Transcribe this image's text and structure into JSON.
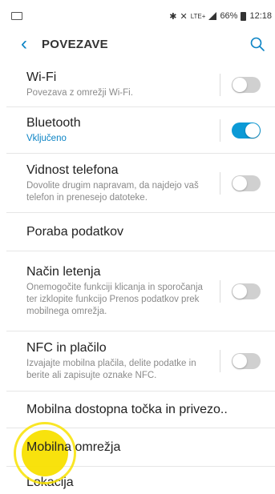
{
  "status_bar": {
    "battery_percent": "66%",
    "time": "12:18",
    "network": "LTE+"
  },
  "header": {
    "title": "POVEZAVE",
    "back_icon": "back-arrow-icon",
    "search_icon": "search-icon"
  },
  "items": [
    {
      "title": "Wi-Fi",
      "subtitle": "Povezava z omrežji Wi-Fi.",
      "toggle": false
    },
    {
      "title": "Bluetooth",
      "subtitle": "Vključeno",
      "toggle": true
    },
    {
      "title": "Vidnost telefona",
      "subtitle": "Dovolite drugim napravam, da najdejo vaš telefon in prenesejo datoteke.",
      "toggle": false
    },
    {
      "title": "Poraba podatkov"
    },
    {
      "title": "Način letenja",
      "subtitle": "Onemogočite funkciji klicanja in sporočanja ter izklopite funkcijo Prenos podatkov prek mobilnega omrežja.",
      "toggle": false
    },
    {
      "title": "NFC in plačilo",
      "subtitle": "Izvajajte mobilna plačila, delite podatke in berite ali zapisujte oznake NFC.",
      "toggle": false
    },
    {
      "title": "Mobilna dostopna točka in privezo.."
    },
    {
      "title": "Mobilna omrežja"
    },
    {
      "title": "Lokacija"
    }
  ],
  "colors": {
    "accent": "#0c84c5",
    "toggle_on": "#0c9ad6",
    "touch_indicator": "#f8e000"
  }
}
